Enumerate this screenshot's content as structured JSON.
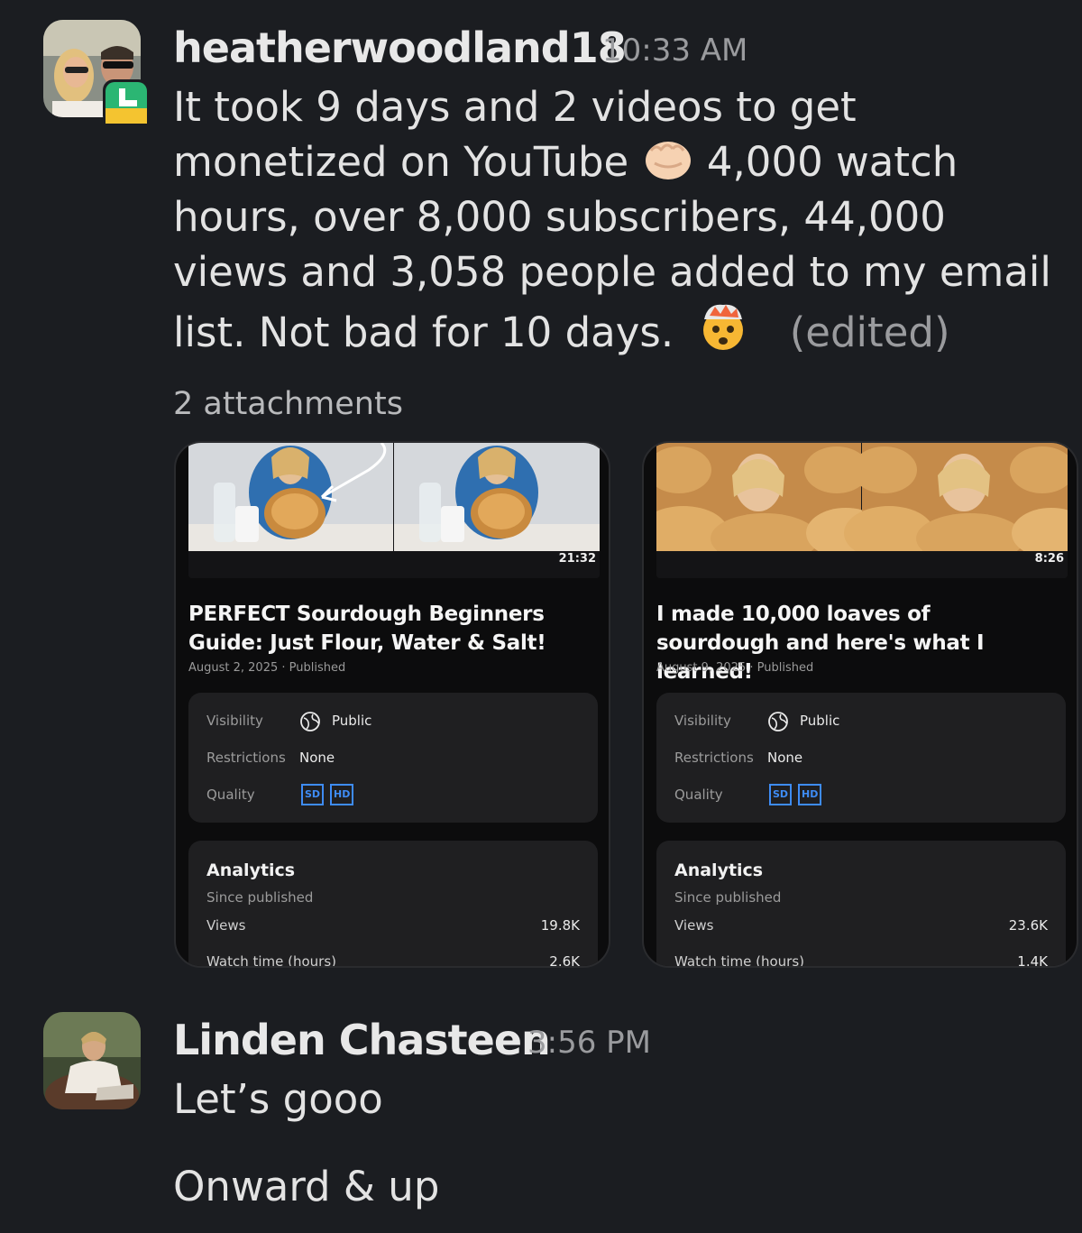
{
  "message1": {
    "sender": "heatherwoodland18",
    "time": "10:33 AM",
    "line1": "It took 9 days and 2 videos to get",
    "line2_a": "monetized on YouTube",
    "line2_b": "4,000 watch",
    "line3": "hours, over 8,000 subscribers, 44,000",
    "line4": "views and 3,058 people added to my email",
    "line5": "list. Not bad for 10 days.",
    "edited": "(edited)",
    "emojis": [
      "fist-bump-emoji",
      "exploding-head-emoji"
    ],
    "attachments_label": "2 attachments"
  },
  "cards": [
    {
      "duration": "21:32",
      "title": "PERFECT Sourdough Beginners Guide: Just Flour, Water & Salt!",
      "date": "August 2, 2025",
      "status": "Published",
      "visibility_label": "Visibility",
      "visibility_value": "Public",
      "restrictions_label": "Restrictions",
      "restrictions_value": "None",
      "quality_label": "Quality",
      "quality_sd": "SD",
      "quality_hd": "HD",
      "analytics_title": "Analytics",
      "analytics_sub": "Since published",
      "views_label": "Views",
      "views_value": "19.8K",
      "watch_label": "Watch time (hours)",
      "watch_value": "2.6K"
    },
    {
      "duration": "8:26",
      "title": "I made 10,000 loaves of sourdough and here's what I learned!",
      "date": "August 9, 2025",
      "status": "Published",
      "visibility_label": "Visibility",
      "visibility_value": "Public",
      "restrictions_label": "Restrictions",
      "restrictions_value": "None",
      "quality_label": "Quality",
      "quality_sd": "SD",
      "quality_hd": "HD",
      "analytics_title": "Analytics",
      "analytics_sub": "Since published",
      "views_label": "Views",
      "views_value": "23.6K",
      "watch_label": "Watch time (hours)",
      "watch_value": "1.4K"
    }
  ],
  "message2": {
    "sender": "Linden Chasteen",
    "time": "3:56 PM",
    "line1": "Let’s gooo",
    "line2": "Onward & up"
  },
  "colors": {
    "background": "#1b1d21",
    "accent_blue": "#3e8cf6",
    "card_bg": "#0c0c0d",
    "panel_bg": "#1f1f21"
  }
}
